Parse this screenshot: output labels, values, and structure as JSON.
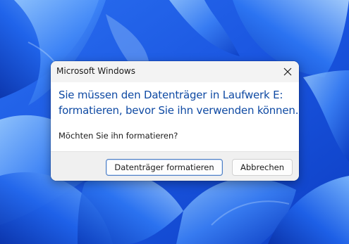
{
  "theme": {
    "accent": "#0f4aa3",
    "wallpaper_base": "#1f62e8"
  },
  "dialog": {
    "title": "Microsoft Windows",
    "close_icon": "close-icon",
    "main_instruction_lines": [
      "Sie müssen den Datenträger in Laufwerk E:",
      "formatieren, bevor Sie ihn verwenden können."
    ],
    "question": "Möchten Sie ihn formatieren?",
    "buttons": {
      "format_label": "Datenträger formatieren",
      "cancel_label": "Abbrechen"
    }
  }
}
